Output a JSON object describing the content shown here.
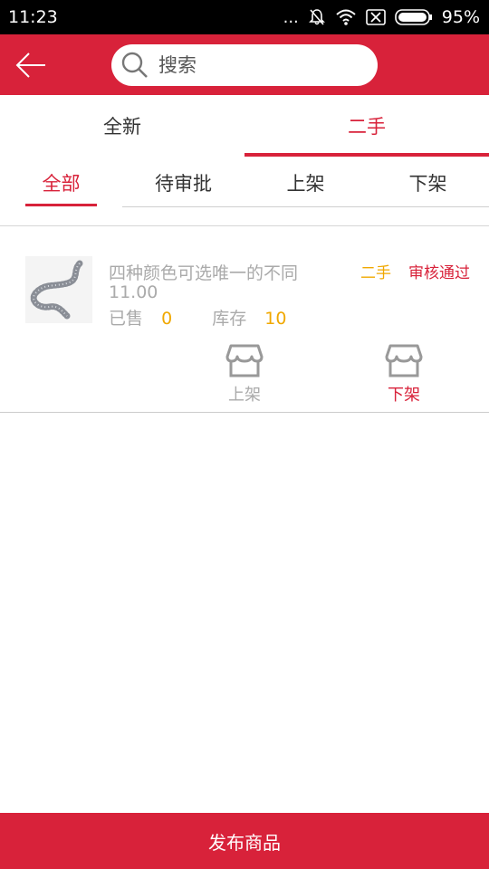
{
  "status_bar": {
    "time": "11:23",
    "dots": "...",
    "battery": "95%"
  },
  "header": {
    "back_icon": "arrow-left-icon",
    "search_placeholder": "搜索"
  },
  "top_tabs": [
    {
      "label": "全新",
      "active": false
    },
    {
      "label": "二手",
      "active": true
    }
  ],
  "sub_tabs": [
    {
      "label": "全部",
      "active": true
    },
    {
      "label": "待审批",
      "active": false
    },
    {
      "label": "上架",
      "active": false
    },
    {
      "label": "下架",
      "active": false
    }
  ],
  "products": [
    {
      "name": "四种颜色可选唯一的不同",
      "price": "11.00",
      "sold_label": "已售",
      "sold": "0",
      "stock_label": "库存",
      "stock": "10",
      "condition": "二手",
      "status": "审核通过",
      "action_on": "上架",
      "action_off": "下架"
    }
  ],
  "footer": {
    "publish_label": "发布商品"
  },
  "colors": {
    "accent": "#d8223a",
    "highlight": "#f0a800",
    "muted": "#aaaaaa"
  }
}
